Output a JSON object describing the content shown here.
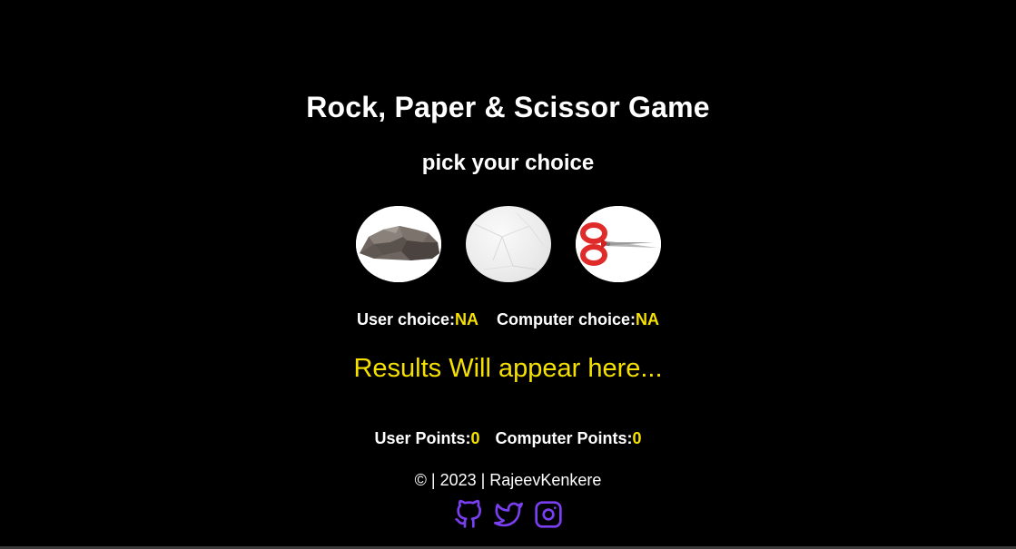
{
  "title": "Rock, Paper & Scissor Game",
  "subtitle": "pick your choice",
  "choices": [
    {
      "name": "rock",
      "icon": "rock-image"
    },
    {
      "name": "paper",
      "icon": "paper-image"
    },
    {
      "name": "scissors",
      "icon": "scissors-image"
    }
  ],
  "status": {
    "user_choice_label": "User choice:",
    "user_choice_value": "NA",
    "computer_choice_label": "Computer choice:",
    "computer_choice_value": "NA"
  },
  "result_text": "Results Will appear here...",
  "points": {
    "user_label": "User Points:",
    "user_value": "0",
    "computer_label": "Computer Points:",
    "computer_value": "0"
  },
  "footer": {
    "text": "© | 2023 | RajeevKenkere"
  },
  "socials": [
    {
      "name": "github",
      "icon": "github-icon"
    },
    {
      "name": "twitter",
      "icon": "twitter-icon"
    },
    {
      "name": "instagram",
      "icon": "instagram-icon"
    }
  ],
  "colors": {
    "background": "#000000",
    "text": "#ffffff",
    "highlight": "#f5e000",
    "social": "#7b3ff2"
  }
}
